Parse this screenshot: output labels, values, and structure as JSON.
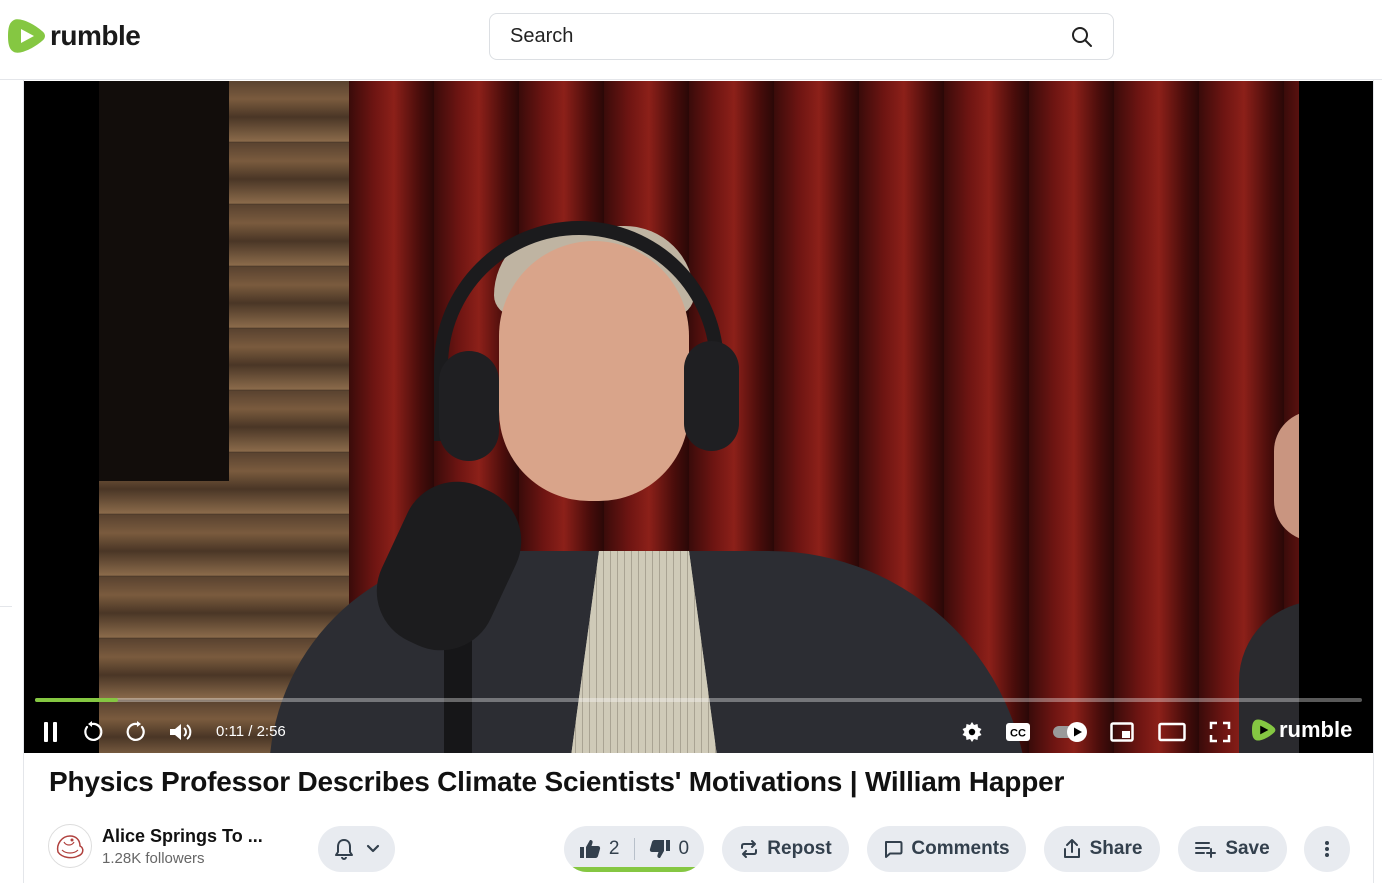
{
  "header": {
    "logo_text": "rumble",
    "search_placeholder": "Search",
    "brand_color": "#85c742"
  },
  "player": {
    "time_display": "0:11 / 2:56",
    "progress_fraction": 0.0625,
    "logo_text": "rumble",
    "controls": [
      "pause-icon",
      "rewind-icon",
      "forward-icon",
      "volume-icon",
      "settings-icon",
      "cc-icon",
      "autoplay-toggle",
      "miniplayer-icon",
      "theater-icon",
      "fullscreen-icon"
    ]
  },
  "video": {
    "title": "Physics Professor Describes Climate Scientists' Motivations | William Happer"
  },
  "channel": {
    "name": "Alice Springs To ...",
    "followers": "1.28K followers"
  },
  "actions": {
    "likes": "2",
    "dislikes": "0",
    "repost_label": "Repost",
    "comments_label": "Comments",
    "share_label": "Share",
    "save_label": "Save"
  }
}
